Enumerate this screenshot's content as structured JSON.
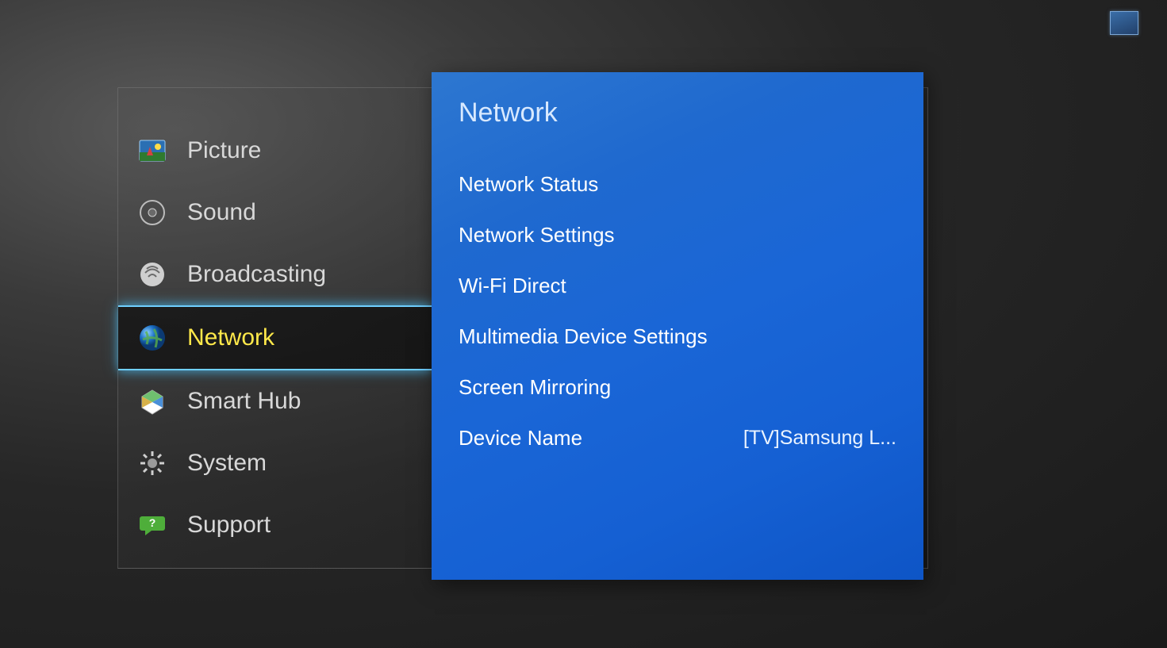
{
  "sidebar": {
    "items": [
      {
        "label": "Picture",
        "icon": "picture-icon",
        "selected": false
      },
      {
        "label": "Sound",
        "icon": "sound-icon",
        "selected": false
      },
      {
        "label": "Broadcasting",
        "icon": "broadcasting-icon",
        "selected": false
      },
      {
        "label": "Network",
        "icon": "network-icon",
        "selected": true
      },
      {
        "label": "Smart Hub",
        "icon": "smart-hub-icon",
        "selected": false
      },
      {
        "label": "System",
        "icon": "system-icon",
        "selected": false
      },
      {
        "label": "Support",
        "icon": "support-icon",
        "selected": false
      }
    ]
  },
  "panel": {
    "title": "Network",
    "items": [
      {
        "label": "Network Status",
        "value": ""
      },
      {
        "label": "Network Settings",
        "value": ""
      },
      {
        "label": "Wi-Fi Direct",
        "value": ""
      },
      {
        "label": "Multimedia Device Settings",
        "value": ""
      },
      {
        "label": "Screen Mirroring",
        "value": ""
      },
      {
        "label": "Device Name",
        "value": "[TV]Samsung L..."
      }
    ]
  }
}
